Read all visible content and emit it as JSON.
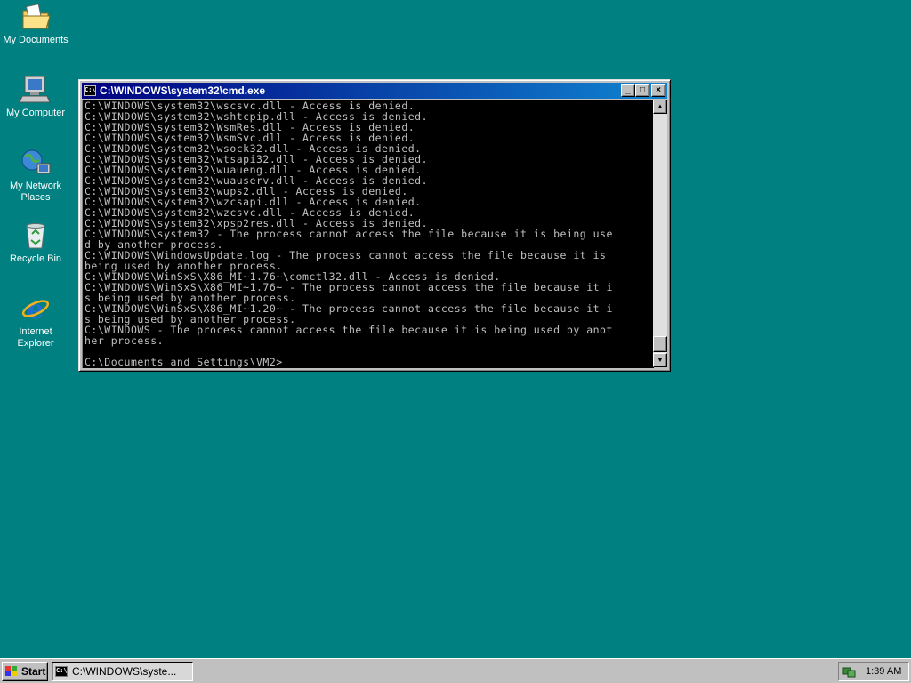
{
  "desktop": {
    "icons": [
      {
        "label": "My Documents",
        "icon": "folder-documents-icon"
      },
      {
        "label": "My Computer",
        "icon": "computer-icon"
      },
      {
        "label": "My Network Places",
        "icon": "network-places-icon"
      },
      {
        "label": "Recycle Bin",
        "icon": "recycle-bin-icon"
      },
      {
        "label": "Internet Explorer",
        "icon": "internet-explorer-icon"
      }
    ]
  },
  "window": {
    "title": "C:\\WINDOWS\\system32\\cmd.exe",
    "icon_text": "C:\\",
    "minimize": "_",
    "maximize": "□",
    "close": "×",
    "console_lines": [
      "C:\\WINDOWS\\system32\\wscsvc.dll - Access is denied.",
      "C:\\WINDOWS\\system32\\wshtcpip.dll - Access is denied.",
      "C:\\WINDOWS\\system32\\WsmRes.dll - Access is denied.",
      "C:\\WINDOWS\\system32\\WsmSvc.dll - Access is denied.",
      "C:\\WINDOWS\\system32\\wsock32.dll - Access is denied.",
      "C:\\WINDOWS\\system32\\wtsapi32.dll - Access is denied.",
      "C:\\WINDOWS\\system32\\wuaueng.dll - Access is denied.",
      "C:\\WINDOWS\\system32\\wuauserv.dll - Access is denied.",
      "C:\\WINDOWS\\system32\\wups2.dll - Access is denied.",
      "C:\\WINDOWS\\system32\\wzcsapi.dll - Access is denied.",
      "C:\\WINDOWS\\system32\\wzcsvc.dll - Access is denied.",
      "C:\\WINDOWS\\system32\\xpsp2res.dll - Access is denied.",
      "C:\\WINDOWS\\system32 - The process cannot access the file because it is being use",
      "d by another process.",
      "C:\\WINDOWS\\WindowsUpdate.log - The process cannot access the file because it is",
      "being used by another process.",
      "C:\\WINDOWS\\WinSxS\\X86_MI~1.76~\\comctl32.dll - Access is denied.",
      "C:\\WINDOWS\\WinSxS\\X86_MI~1.76~ - The process cannot access the file because it i",
      "s being used by another process.",
      "C:\\WINDOWS\\WinSxS\\X86_MI~1.20~ - The process cannot access the file because it i",
      "s being used by another process.",
      "C:\\WINDOWS - The process cannot access the file because it is being used by anot",
      "her process.",
      "",
      "C:\\Documents and Settings\\VM2>"
    ]
  },
  "taskbar": {
    "start_label": "Start",
    "task_label": "C:\\WINDOWS\\syste...",
    "clock": "1:39 AM"
  }
}
